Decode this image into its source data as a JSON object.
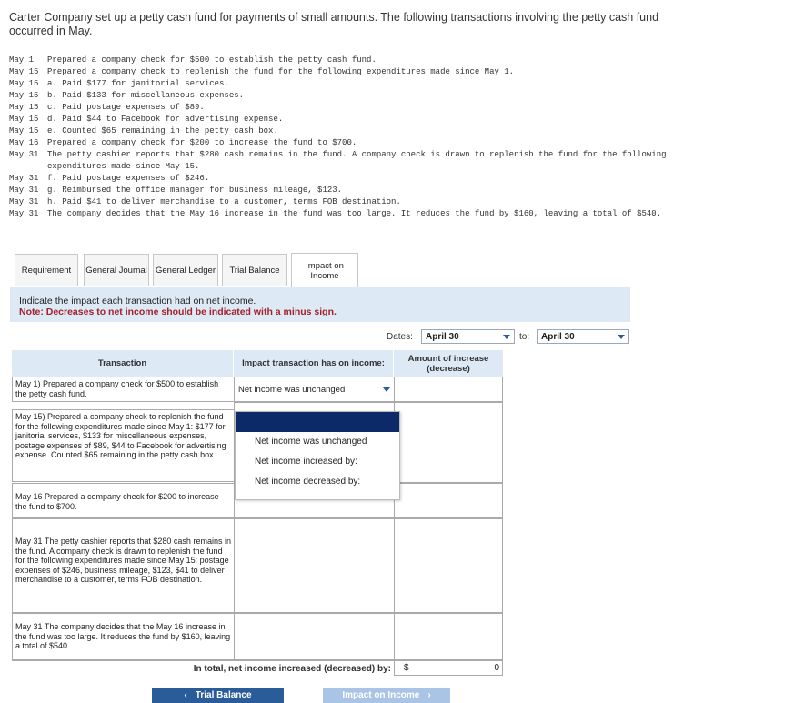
{
  "intro": "Carter Company set up a petty cash fund for payments of small amounts. The following transactions involving the petty cash fund occurred in May.",
  "transactions_list": [
    {
      "date": "May 1",
      "text": "Prepared a company check for $500 to establish the petty cash fund."
    },
    {
      "date": "May 15",
      "text": "Prepared a company check to replenish the fund for the following expenditures made since May 1."
    },
    {
      "date": "May 15",
      "text": "a. Paid $177 for janitorial services."
    },
    {
      "date": "May 15",
      "text": "b. Paid $133 for miscellaneous expenses."
    },
    {
      "date": "May 15",
      "text": "c. Paid postage expenses of $89."
    },
    {
      "date": "May 15",
      "text": "d. Paid $44 to Facebook for advertising expense."
    },
    {
      "date": "May 15",
      "text": "e. Counted $65 remaining in the petty cash box."
    },
    {
      "date": "May 16",
      "text": "Prepared a company check for $200 to increase the fund to $700."
    },
    {
      "date": "May 31",
      "text": "The petty cashier reports that $280 cash remains in the fund. A company check is drawn to replenish the fund for the following expenditures made since May 15."
    },
    {
      "date": "May 31",
      "text": "f. Paid postage expenses of $246."
    },
    {
      "date": "May 31",
      "text": "g. Reimbursed the office manager for business mileage, $123."
    },
    {
      "date": "May 31",
      "text": "h. Paid $41 to deliver merchandise to a customer, terms FOB destination."
    },
    {
      "date": "May 31",
      "text": "The company decides that the May 16 increase in the fund was too large. It reduces the fund by $160, leaving a total of $540."
    }
  ],
  "tabs": {
    "requirement": "Requirement",
    "general_journal": "General Journal",
    "general_ledger": "General Ledger",
    "trial_balance": "Trial Balance",
    "impact_on_income": "Impact on Income"
  },
  "instructions": {
    "main": "Indicate the impact each transaction had on net income.",
    "note": "Note: Decreases to net income should be indicated with a minus sign."
  },
  "dates": {
    "label": "Dates:",
    "from": "April 30",
    "to_label": "to:",
    "to": "April 30"
  },
  "table": {
    "col_transaction": "Transaction",
    "col_impact": "Impact transaction has on income:",
    "col_amount": "Amount of increase (decrease)",
    "rows": [
      {
        "transaction": "May 1) Prepared a company check for $500 to establish the petty cash fund.",
        "impact": "Net income was unchanged",
        "amount": ""
      },
      {
        "transaction": "May 15) Prepared a company check to replenish the fund for the following expenditures made since May 1: $177 for janitorial services, $133 for miscellaneous expenses, postage expenses of $89, $44 to Facebook for advertising expense. Counted $65 remaining in the petty cash box.",
        "impact": "",
        "amount": ""
      },
      {
        "transaction": "May 16 Prepared a company check for $200 to increase the fund to $700.",
        "impact": "",
        "amount": ""
      },
      {
        "transaction": "May 31 The petty cashier reports that $280 cash remains in the fund. A company check is drawn to replenish the fund for the following expenditures made since May 15: postage expenses of $246, business mileage, $123, $41 to deliver merchandise to a customer, terms FOB destination.",
        "impact": "",
        "amount": ""
      },
      {
        "transaction": "May 31 The company decides that the May 16 increase in the fund was too large. It reduces the fund by $160, leaving a total of $540.",
        "impact": "",
        "amount": ""
      }
    ],
    "dropdown_options": [
      "Net income was unchanged",
      "Net income increased by:",
      "Net income decreased by:"
    ],
    "total_label": "In total, net income increased (decreased) by:",
    "total_currency": "$",
    "total_value": "0"
  },
  "nav": {
    "prev_label": "Trial Balance",
    "prev_icon": "chevron-left-icon",
    "next_label": "Impact on Income",
    "next_icon": "chevron-right-icon"
  },
  "colors": {
    "tab_header_bg": "#dde9f5",
    "note_red": "#a3212a",
    "button_blue": "#2b5c9a",
    "menu_selected": "#0c2a68"
  }
}
